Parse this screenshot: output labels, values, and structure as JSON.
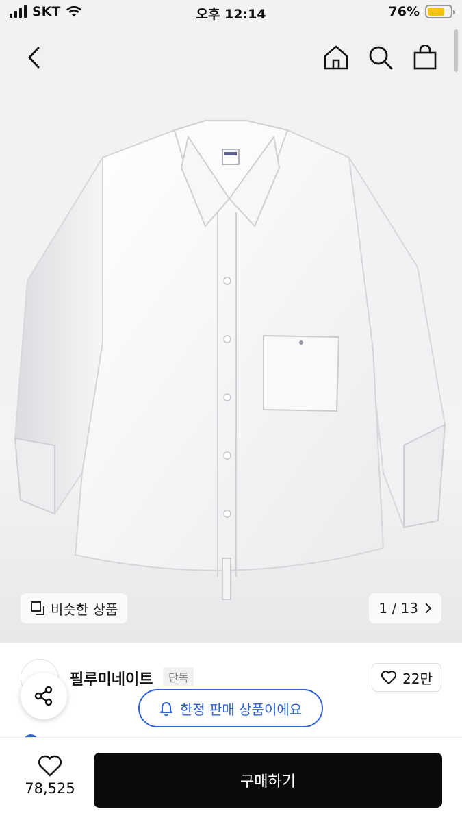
{
  "status_bar": {
    "carrier": "SKT",
    "time": "오후 12:14",
    "battery": "76%",
    "battery_level": 0.76
  },
  "header": {
    "back_icon": "chevron-left-icon",
    "home_icon": "home-icon",
    "search_icon": "search-icon",
    "bag_icon": "shopping-bag-icon"
  },
  "gallery": {
    "similar_label": "비슷한 상품",
    "counter": "1 / 13",
    "image_description_icon": "white-shirt-image"
  },
  "seller": {
    "name": "필루미네이트",
    "tag": "단독",
    "likes": "22만"
  },
  "notice": {
    "limited_label": "한정 판매 상품이에요"
  },
  "bottom_bar": {
    "wish_count": "78,525",
    "buy_label": "구매하기"
  },
  "colors": {
    "accent_blue": "#2f62d6",
    "buy_button": "#0b0b0b",
    "battery": "#f6c40e"
  }
}
